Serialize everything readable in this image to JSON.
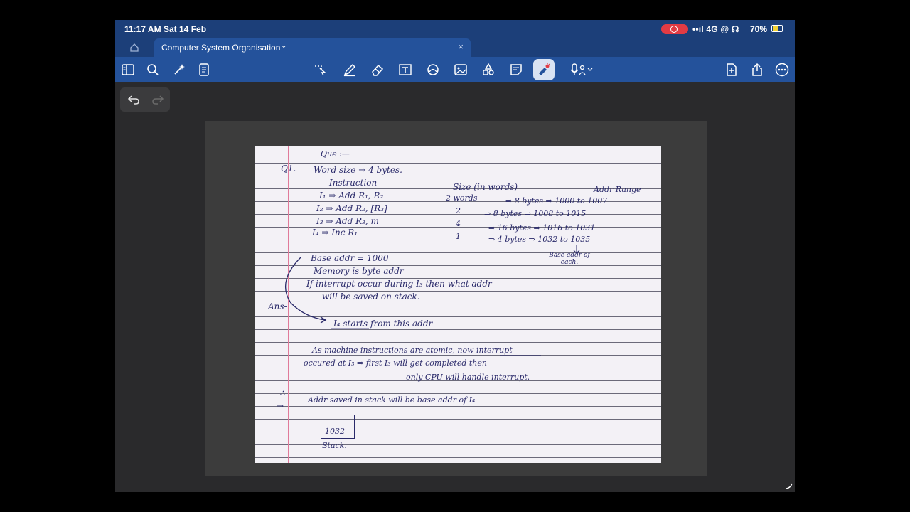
{
  "status": {
    "time": "11:17 AM",
    "date": "Sat 14 Feb",
    "network": "••ıl 4G @ ☊",
    "battery": "70%",
    "colors": {
      "bar": "#1c3f79",
      "record": "#e23b44"
    }
  },
  "tab": {
    "title": "Computer System Organisation",
    "chevron": "⌄",
    "close": "×"
  },
  "toolbar": {
    "icons": [
      "sidebar-icon",
      "search-icon",
      "sparkle-icon",
      "document-icon",
      "lasso-icon",
      "pen-icon",
      "eraser-icon",
      "text-box-icon",
      "shapes-icon",
      "image-icon",
      "elements-icon",
      "sticky-note-icon",
      "laser-pointer-icon",
      "microphone-icon",
      "add-page-icon",
      "share-icon",
      "more-icon"
    ],
    "active": "laser-pointer-icon"
  },
  "note": {
    "header": "Que :—",
    "q_label": "Q1.",
    "word_size": "Word size ⇒ 4 bytes.",
    "col_instruction": "Instruction",
    "col_size": "Size (in words)",
    "col_range": "Addr Range",
    "rows": [
      {
        "instr": "I₁ ⇒ Add R₁, R₂",
        "size": "2 words",
        "bytes": "⇒ 8 bytes ⇒ 1000 to 1007"
      },
      {
        "instr": "I₂ ⇒ Add R₂, [R₃]",
        "size": "2",
        "bytes": "⇒ 8 bytes ⇒ 1008 to 1015"
      },
      {
        "instr": "I₃ ⇒ Add R₃, m",
        "size": "4",
        "bytes": "⇒ 16 bytes ⇒ 1016 to 1031"
      },
      {
        "instr": "I₄ ⇒ Inc R₁",
        "size": "1",
        "bytes": "⇒ 4 bytes ⇒ 1032 to 1035"
      }
    ],
    "base_note": "Base addr of each.",
    "base_addr": "Base addr = 1000",
    "memory": "Memory is byte addr",
    "question_line1": "If interrupt occur during I₃ then what addr",
    "question_line2": "will be saved on stack.",
    "ans_label": "Ans-",
    "i4_starts": "I₄ starts from this addr",
    "atomic_line1": "As machine instructions are atomic, now interrupt",
    "atomic_line2": "occured at I₃ ⇒ first I₃ will get completed then",
    "atomic_line3": "only CPU will handle interrupt.",
    "therefore": "∴",
    "implies": "⇒",
    "saved_line": "Addr saved in stack will be base addr of I₄",
    "stack_value": "1032",
    "stack_label": "Stack."
  }
}
